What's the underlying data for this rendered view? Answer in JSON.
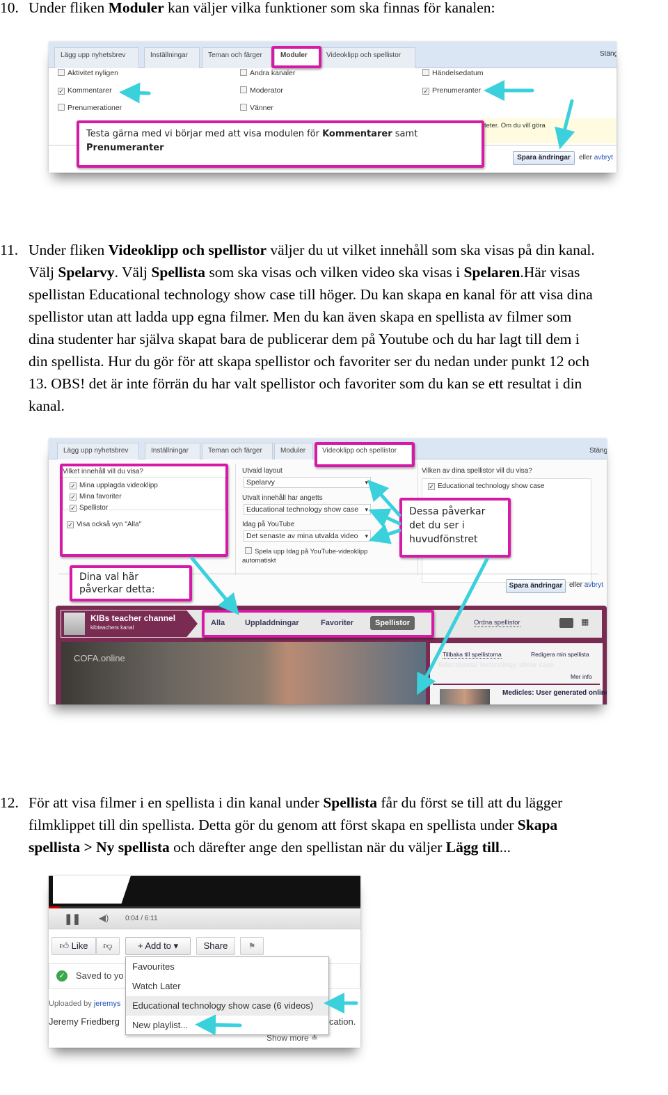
{
  "item10": {
    "num": "10.",
    "pre": "Under fliken ",
    "bold": "Moduler",
    "post": " kan väljer vilka funktioner som ska finnas för kanalen:"
  },
  "shot1": {
    "tabs": [
      "Lägg upp nyhetsbrev",
      "Inställningar",
      "Teman och färger",
      "Moduler",
      "Videoklipp och spellistor"
    ],
    "close": "Stäng",
    "modules": [
      {
        "label": "Aktivitet nyligen",
        "checked": false
      },
      {
        "label": "Kommentarer",
        "checked": true
      },
      {
        "label": "Prenumerationer",
        "checked": false
      },
      {
        "label": "Andra kanaler",
        "checked": false
      },
      {
        "label": "Moderator",
        "checked": false
      },
      {
        "label": "Vänner",
        "checked": false
      },
      {
        "label": "Händelsedatum",
        "checked": false
      },
      {
        "label": "Prenumeranter",
        "checked": true
      }
    ],
    "callout": {
      "pre": "Testa gärna med vi börjar med att visa modulen för ",
      "bold1": "Kommentarer",
      "mid": " samt",
      "bold2": "Prenumeranter"
    },
    "notice": "teter. Om du vill göra",
    "save": "Spara ändringar",
    "or": "eller",
    "cancel": "avbryt"
  },
  "item11": {
    "num": "11.",
    "lines": [
      [
        "Under fliken ",
        "Videoklipp och spellistor",
        " väljer du ut vilket innehåll som ska visas på din kanal."
      ],
      [
        "Välj ",
        "Spelarvy",
        ". Välj ",
        "Spellista",
        " som ska visas och vilken video ska visas i ",
        "Spelaren",
        ".Här visas"
      ],
      [
        "spellistan Educational technology show case till höger. Du kan skapa en kanal för att visa dina"
      ],
      [
        "spellistor utan att ladda upp egna filmer. Men du kan även skapa en spellista av filmer som"
      ],
      [
        "dina studenter har själva skapat bara de publicerar dem på Youtube och du har lagt till dem i"
      ],
      [
        "din spellista. Hur du gör för att skapa spellistor och favoriter ser du nedan under punkt 12 och"
      ],
      [
        "13. OBS! det är inte förrän du har valt spellistor och favoriter som du kan se ett resultat i din"
      ],
      [
        "kanal."
      ]
    ]
  },
  "shot2": {
    "tabs": [
      "Lägg upp nyhetsbrev",
      "Inställningar",
      "Teman och färger",
      "Moduler",
      "Videoklipp och spellistor"
    ],
    "close": "Stäng",
    "content_q": "Vilket innehåll vill du visa?",
    "content_items": [
      {
        "label": "Mina upplagda videoklipp",
        "checked": true
      },
      {
        "label": "Mina favoriter",
        "checked": true
      },
      {
        "label": "Spellistor",
        "checked": true
      }
    ],
    "show_all": {
      "label": "Visa också vyn \"Alla\"",
      "checked": true
    },
    "layout_label": "Utvald layout",
    "layout_value": "Spelarvy",
    "featured_label": "Utvalt innehåll har angetts",
    "featured_value": "Educational technology show case",
    "today_label": "Idag på YouTube",
    "today_value": "Det senaste av mina utvalda video",
    "autoplay": {
      "label": "Spela upp Idag på YouTube-videoklipp",
      "label2": "automatiskt",
      "checked": false
    },
    "playlist_q": "Vilken av dina spellistor vill du visa?",
    "playlist_item": {
      "label": "Educational technology show case",
      "checked": true
    },
    "callout_right": "Dessa påverkar det du ser i huvudfönstret",
    "callout_left": "Dina val här påverkar detta:",
    "save": "Spara ändringar",
    "or": "eller",
    "cancel": "avbryt",
    "channel": {
      "title": "KIBs teacher channel",
      "subtitle": "kibteachers kanal",
      "tabs": [
        "Alla",
        "Uppladdningar",
        "Favoriter",
        "Spellistor"
      ],
      "active_tab": "Spellistor",
      "arrange": "Ordna spellistor",
      "video_logo": "COFA.online",
      "back": "Tillbaka till spellistorna",
      "edit": "Redigera min spellista",
      "playlist_title": "Educational technology show case",
      "more": "Mer info",
      "video_item": "Medicles: User generated online"
    }
  },
  "item12": {
    "num": "12.",
    "lines": [
      [
        "För att visa filmer i en spellista i din kanal under ",
        "Spellista",
        " får du först se till att du lägger"
      ],
      [
        "filmklippet till din spellista. Detta gör du genom att först skapa en spellista under ",
        "Skapa"
      ],
      [
        "",
        "spellista > Ny spellista",
        " och därefter ange den spellistan när du väljer ",
        "Lägg till",
        "..."
      ]
    ]
  },
  "shot3": {
    "time": "0:04 / 6:11",
    "like": "Like",
    "add_to": "Add to",
    "share": "Share",
    "saved": "Saved to yo",
    "uploaded": "Uploaded by ",
    "uploader": "jeremys",
    "author": "Jeremy Friedberg",
    "desc_tail": "cation.",
    "show_more": "Show more",
    "menu": [
      "Favourites",
      "Watch Later",
      "Educational technology show case (6 videos)",
      "New playlist..."
    ]
  },
  "colors": {
    "highlight": "#d61aa6",
    "arrow": "#3ad0dc",
    "channel": "#7a2b52",
    "tabbar": "#dbe6f4"
  }
}
